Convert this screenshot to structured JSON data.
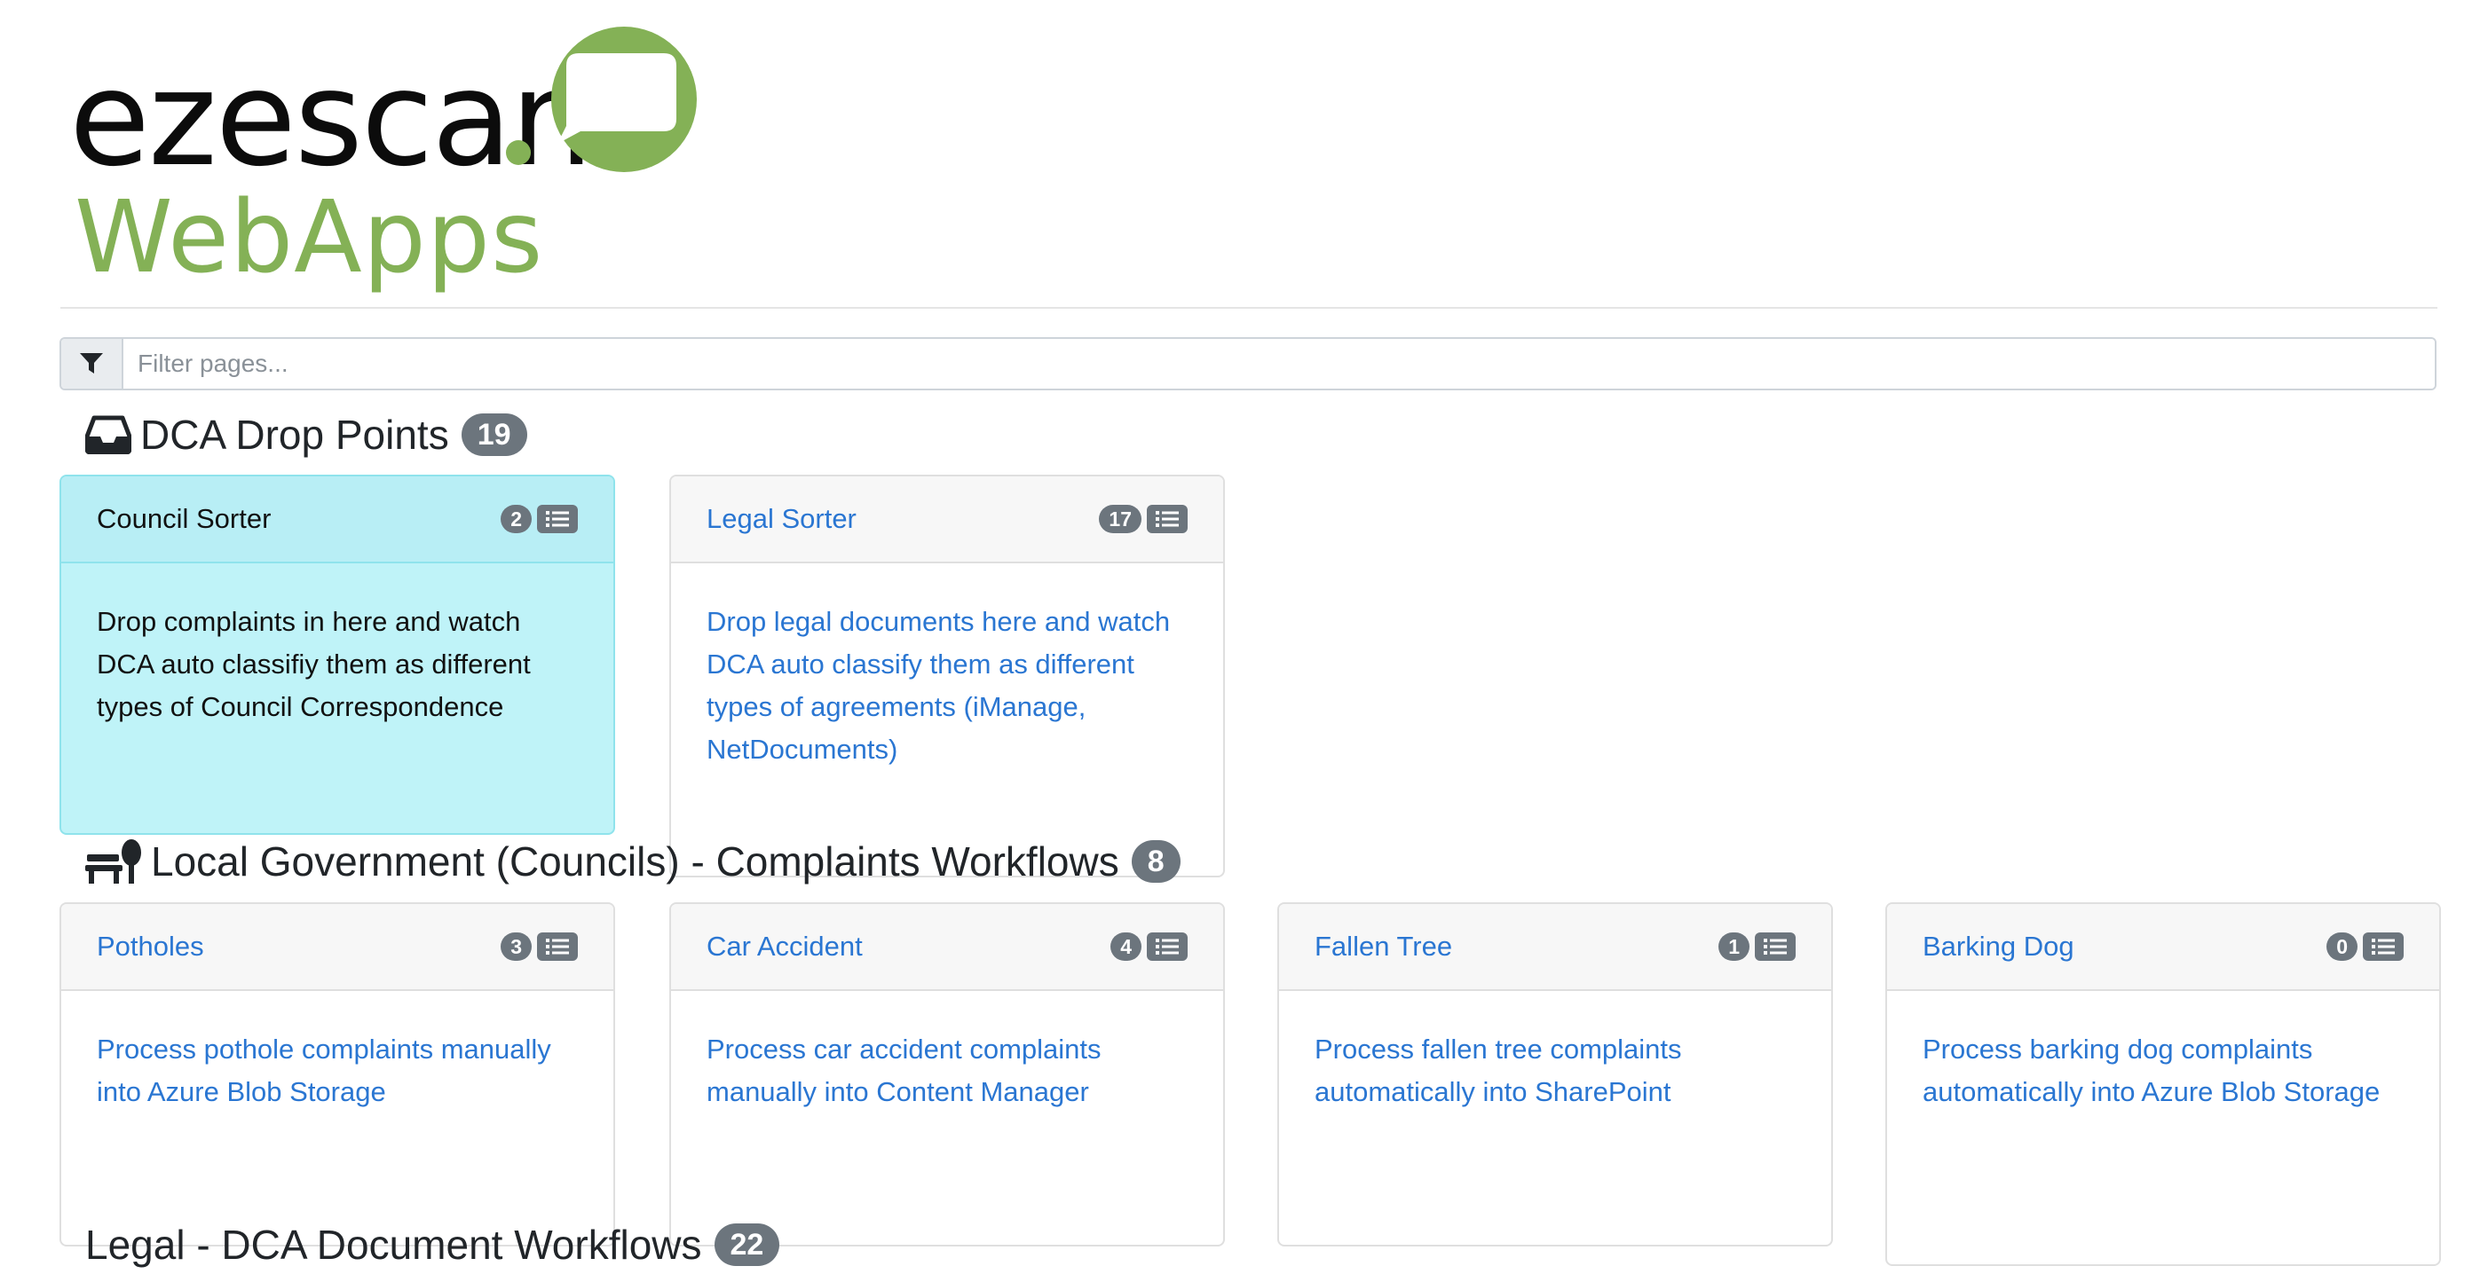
{
  "logo": {
    "word": "ezescan",
    "sub": "WebApps",
    "brand_green": "#84b156"
  },
  "filter": {
    "placeholder": "Filter pages...",
    "icon": "filter-icon"
  },
  "sections": [
    {
      "title": "DCA Drop Points",
      "count": "19",
      "icon": "inbox-icon"
    },
    {
      "title": "Local Government (Councils) - Complaints Workflows",
      "count": "8",
      "icon": "bench-tree-icon"
    },
    {
      "title": "Legal - DCA Document Workflows",
      "count": "22"
    }
  ],
  "drop_points": [
    {
      "title": "Council Sorter",
      "count": "2",
      "active": true,
      "desc": "Drop complaints in here and watch DCA auto classifiy them as different types of Council Correspondence"
    },
    {
      "title": "Legal Sorter",
      "count": "17",
      "active": false,
      "desc": "Drop legal documents here and watch DCA auto classify them as different types of agreements (iManage, NetDocuments)"
    }
  ],
  "council_workflows": [
    {
      "title": "Potholes",
      "count": "3",
      "desc": "Process pothole complaints manually into Azure Blob Storage"
    },
    {
      "title": "Car Accident",
      "count": "4",
      "desc": "Process car accident complaints manually into Content Manager"
    },
    {
      "title": "Fallen Tree",
      "count": "1",
      "desc": "Process fallen tree complaints automatically into SharePoint"
    },
    {
      "title": "Barking Dog",
      "count": "0",
      "desc": "Process barking dog complaints automatically into Azure Blob Storage"
    }
  ],
  "colors": {
    "link": "#2a76d2",
    "badge": "#6c757d",
    "active_card": "#bff3f8"
  }
}
